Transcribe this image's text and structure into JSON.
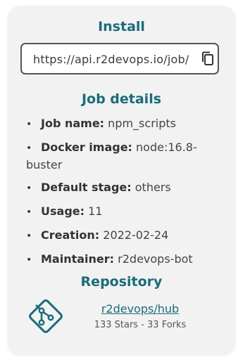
{
  "install": {
    "title": "Install",
    "url": "https://api.r2devops.io/job/",
    "copy_icon": "copy-icon"
  },
  "details": {
    "title": "Job details",
    "items": [
      {
        "key": "Job name:",
        "value": "npm_scripts"
      },
      {
        "key": "Docker image:",
        "value": "node:16.8-buster"
      },
      {
        "key": "Default stage:",
        "value": "others"
      },
      {
        "key": "Usage:",
        "value": "11"
      },
      {
        "key": "Creation:",
        "value": "2022-02-24"
      },
      {
        "key": "Maintainer:",
        "value": "r2devops-bot"
      }
    ]
  },
  "repository": {
    "title": "Repository",
    "icon": "git-icon",
    "link": "r2devops/hub",
    "stats": "133 Stars - 33 Forks"
  },
  "colors": {
    "accent": "#1b6b7a",
    "card_bg": "#f2f2f2"
  }
}
